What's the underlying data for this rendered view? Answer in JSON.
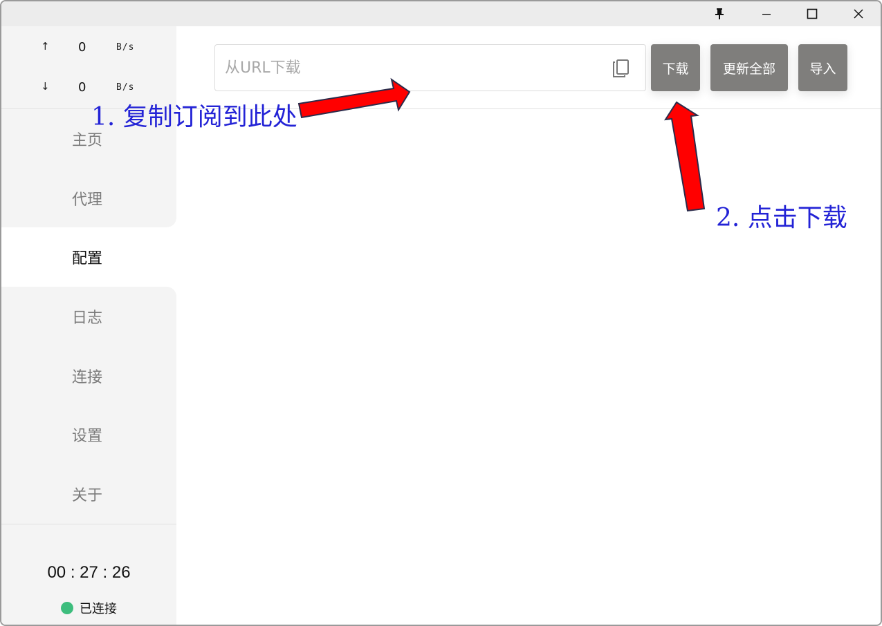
{
  "window": {
    "pin_icon": "pin-icon",
    "minimize_icon": "minimize-icon",
    "maximize_icon": "maximize-icon",
    "close_icon": "close-icon"
  },
  "traffic": {
    "up_arrow": "↑",
    "up_value": "0",
    "up_unit": "B/s",
    "down_arrow": "↓",
    "down_value": "0",
    "down_unit": "B/s"
  },
  "nav": {
    "items": [
      {
        "label": "主页",
        "active": false
      },
      {
        "label": "代理",
        "active": false
      },
      {
        "label": "配置",
        "active": true
      },
      {
        "label": "日志",
        "active": false
      },
      {
        "label": "连接",
        "active": false
      },
      {
        "label": "设置",
        "active": false
      },
      {
        "label": "关于",
        "active": false
      }
    ]
  },
  "status": {
    "timer": "00 : 27 : 26",
    "connection": "已连接",
    "connection_color": "#3dbd7d"
  },
  "toolbar": {
    "url_placeholder": "从URL下载",
    "url_value": "",
    "paste_icon": "paste-icon",
    "download_label": "下载",
    "update_all_label": "更新全部",
    "import_label": "导入"
  },
  "annotations": {
    "step1": "1. 复制订阅到此处",
    "step2": "2. 点击下载",
    "text_color": "#2323d6",
    "arrow_color": "#ff0000"
  }
}
